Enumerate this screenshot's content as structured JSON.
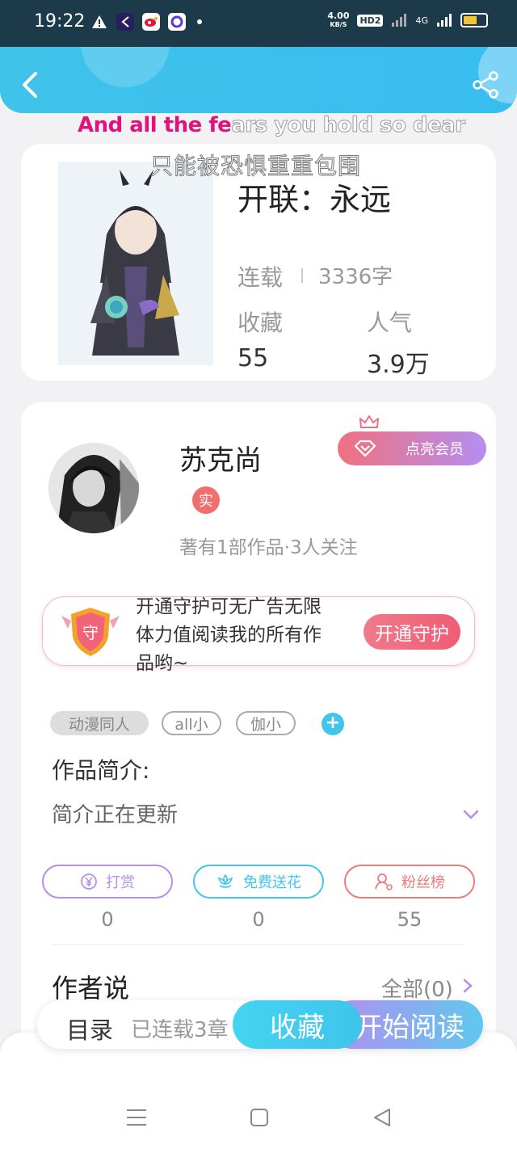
{
  "status_bar": {
    "time": "19:22",
    "net_speed_value": "4.00",
    "net_speed_unit": "KB/S",
    "hd": "HD2",
    "signal": "4G"
  },
  "lyrics": {
    "line1_highlight": "And all the fe",
    "line1_rest": "ars you hold so dear",
    "line2": "只能被恐惧重重包围"
  },
  "book": {
    "title": "开联：永远",
    "status_label": "连载",
    "word_count": "3336字",
    "collect_label": "收藏",
    "collect_value": "55",
    "popularity_label": "人气",
    "popularity_value": "3.9万"
  },
  "author": {
    "name": "苏克尚",
    "verified_badge": "实",
    "meta": "著有1部作品·3人关注",
    "vip_button": "点亮会员"
  },
  "guard": {
    "shield_char": "守",
    "text": "开通守护可无广告无限体力值阅读我的所有作品哟~",
    "button": "开通守护"
  },
  "tags": [
    "动漫同人",
    "all小",
    "伽小"
  ],
  "add_tag": "+",
  "intro": {
    "title": "作品简介:",
    "text": "简介正在更新"
  },
  "actions": [
    {
      "label": "打赏",
      "count": "0",
      "color": "#b48ef0",
      "icon": "yen-icon"
    },
    {
      "label": "免费送花",
      "count": "0",
      "color": "#43c4ec",
      "icon": "flower-icon"
    },
    {
      "label": "粉丝榜",
      "count": "55",
      "color": "#ef7a7a",
      "icon": "user-icon"
    }
  ],
  "author_says": {
    "title": "作者说",
    "all": "全部(0)"
  },
  "bottom_bar": {
    "toc": "目录",
    "chapters": "已连载3章",
    "favorite": "收藏",
    "start_reading": "开始阅读"
  },
  "colors": {
    "header": "#3fc3ea",
    "accent_pink": "#ef5d75",
    "accent_purple": "#b48ef0"
  }
}
